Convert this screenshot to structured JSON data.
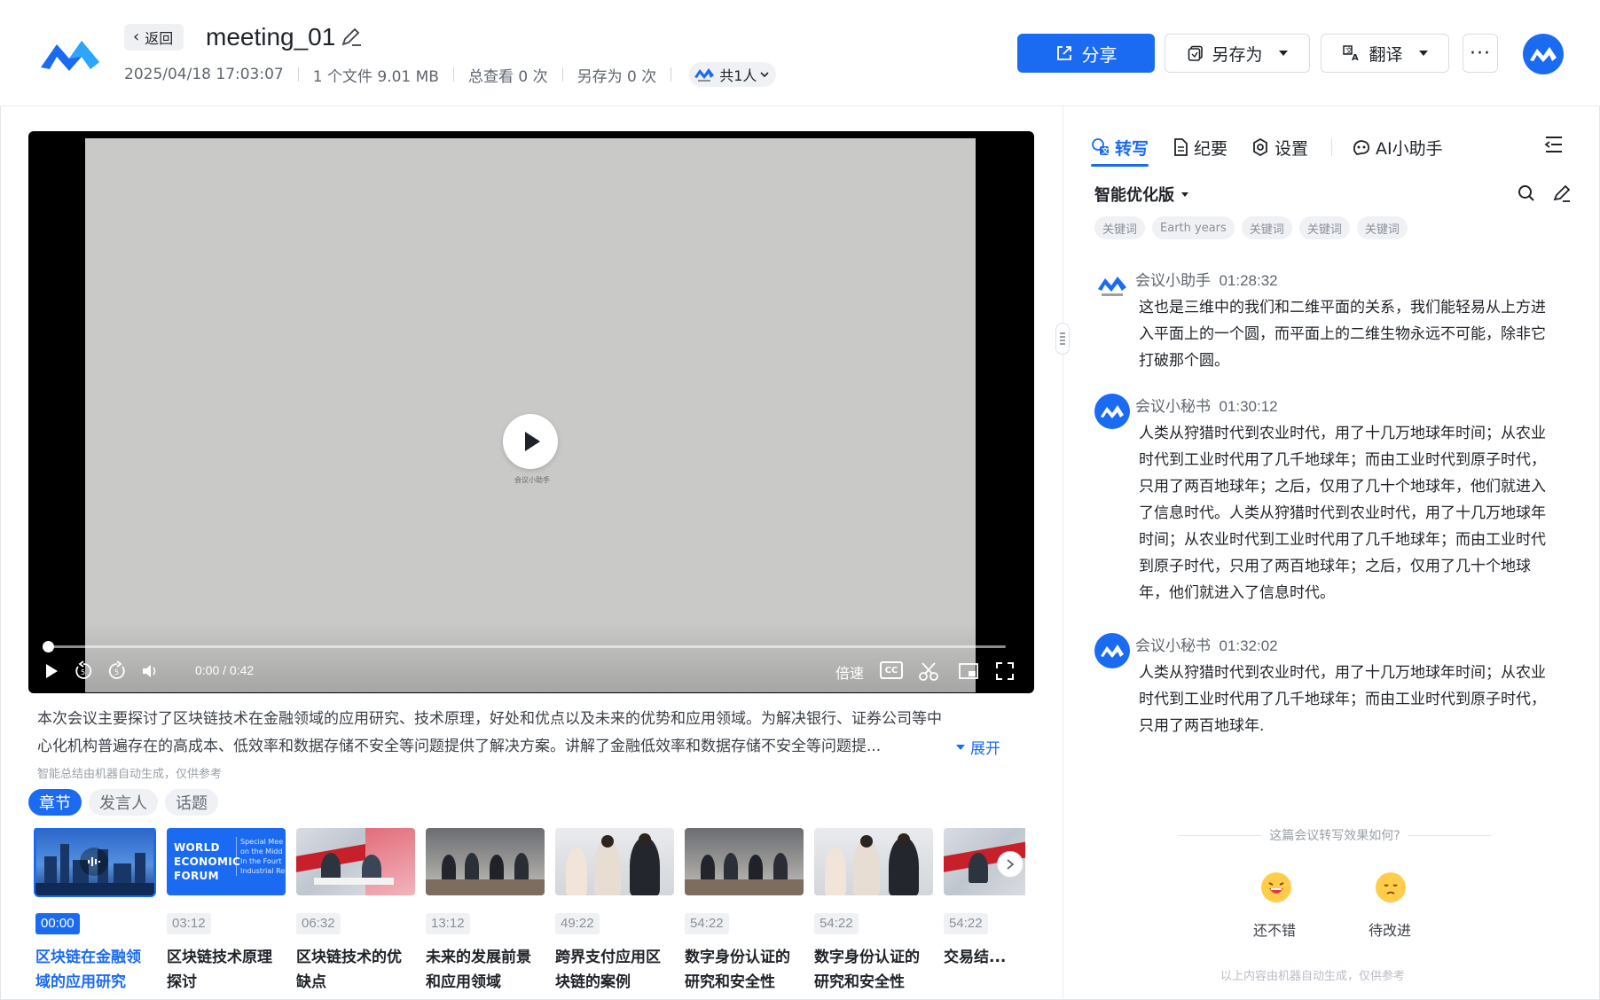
{
  "header": {
    "back_label": "返回",
    "title": "meeting_01",
    "meta": {
      "datetime": "2025/04/18 17:03:07",
      "files": "1 个文件 9.01 MB",
      "views": "总查看 0 次",
      "saves": "另存为 0 次",
      "members": "共1人"
    },
    "share_label": "分享",
    "saveas_label": "另存为",
    "translate_label": "翻译",
    "more_label": "···"
  },
  "player": {
    "time": "0:00 / 0:42",
    "speed_label": "倍速",
    "cc_label": "CC",
    "progress": 0,
    "watermark": "会议小助手"
  },
  "summary": {
    "line1": "本次会议主要探讨了区块链技术在金融领域的应用研究、技术原理，好处和优点以及未来的优势和应用领域。为解决银行、证券公司等中",
    "line2": "心化机构普遍存在的高成本、低效率和数据存储不安全等问题提供了解决方案。讲解了金融低效率和数据存储不安全等问题提...",
    "expand_label": "展开",
    "disclaimer": "智能总结由机器自动生成，仅供参考"
  },
  "tabs": [
    {
      "label": "章节",
      "active": true
    },
    {
      "label": "发言人",
      "active": false
    },
    {
      "label": "话题",
      "active": false
    }
  ],
  "chapters": [
    {
      "time": "00:00",
      "title_l1": "区块链在金融领",
      "title_l2": "域的应用研究",
      "active": true
    },
    {
      "time": "03:12",
      "title_l1": "区块链技术原理",
      "title_l2": "探讨",
      "active": false
    },
    {
      "time": "06:32",
      "title_l1": "区块链技术的优",
      "title_l2": "缺点",
      "active": false
    },
    {
      "time": "13:12",
      "title_l1": "未来的发展前景",
      "title_l2": "和应用领域",
      "active": false
    },
    {
      "time": "49:22",
      "title_l1": "跨界支付应用区",
      "title_l2": "块链的案例",
      "active": false
    },
    {
      "time": "54:22",
      "title_l1": "数字身份认证的",
      "title_l2": "研究和安全性",
      "active": false
    },
    {
      "time": "54:22",
      "title_l1": "数字身份认证的",
      "title_l2": "研究和安全性",
      "active": false
    },
    {
      "time": "54:22",
      "title_l1": "交易结...",
      "title_l2": "",
      "active": false
    }
  ],
  "thumb_text": {
    "wef_l1": "WORLD",
    "wef_l2": "ECONOMIC",
    "wef_l3": "FORUM",
    "wef_s1": "Special Mee",
    "wef_s2": "on the Midd",
    "wef_s3": "In the Fourt",
    "wef_s4": "Industrial Re"
  },
  "right_tabs": [
    {
      "label": "转写",
      "icon": "transcript-icon",
      "active": true
    },
    {
      "label": "纪要",
      "icon": "document-icon",
      "active": false
    },
    {
      "label": "设置",
      "icon": "gear-icon",
      "active": false
    },
    {
      "label": "AI小助手",
      "icon": "ai-assistant-icon",
      "active": false
    }
  ],
  "version_label": "智能优化版",
  "keywords": [
    "关键词",
    "Earth years",
    "关键词",
    "关键词",
    "关键词"
  ],
  "messages": [
    {
      "speaker": "会议小助手",
      "time": "01:28:32",
      "lines": [
        "这也是三维中的我们和二维平面的关系，我们能轻易从上方进",
        "入平面上的一个圆，而平面上的二维生物永远不可能，除非它",
        "打破那个圆。"
      ]
    },
    {
      "speaker": "会议小秘书",
      "time": "01:30:12",
      "lines": [
        "人类从狩猎时代到农业时代，用了十几万地球年时间；从农业",
        "时代到工业时代用了几千地球年；而由工业时代到原子时代，",
        "只用了两百地球年；之后，仅用了几十个地球年，他们就进入",
        "了信息时代。人类从狩猎时代到农业时代，用了十几万地球年",
        "时间；从农业时代到工业时代用了几千地球年；而由工业时代",
        "到原子时代，只用了两百地球年；之后，仅用了几十个地球",
        "年，他们就进入了信息时代。"
      ]
    },
    {
      "speaker": "会议小秘书",
      "time": "01:32:02",
      "lines": [
        "人类从狩猎时代到农业时代，用了十几万地球年时间；从农业",
        "时代到工业时代用了几千地球年；而由工业时代到原子时代，",
        "只用了两百地球年."
      ]
    }
  ],
  "feedback": {
    "question": "这篇会议转写效果如何?",
    "good_label": "还不错",
    "bad_label": "待改进"
  },
  "footer_note": "以上内容由机器自动生成，仅供参考",
  "colors": {
    "accent": "#1b6bf2",
    "text": "#1f2329",
    "muted": "#9aa0a8",
    "emoji": "#ffcd4a"
  }
}
